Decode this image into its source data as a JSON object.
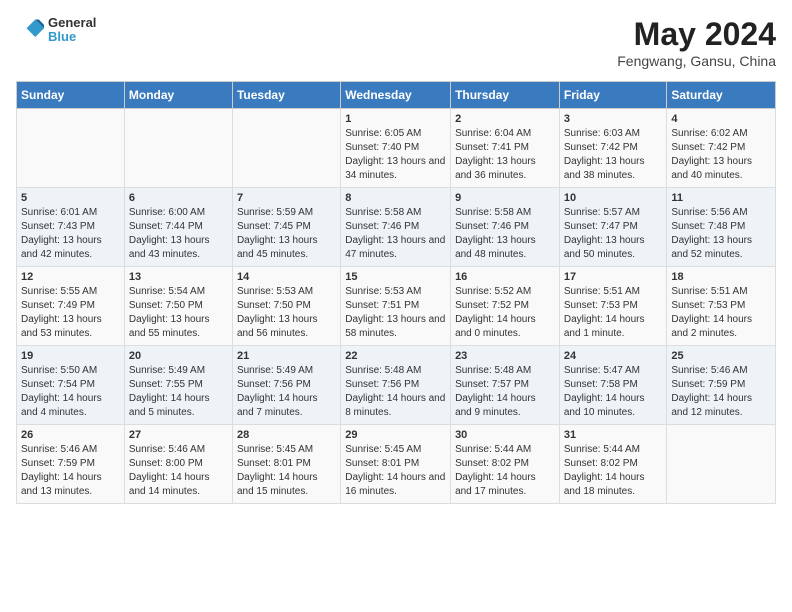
{
  "header": {
    "logo_line1": "General",
    "logo_line2": "Blue",
    "title": "May 2024",
    "subtitle": "Fengwang, Gansu, China"
  },
  "weekdays": [
    "Sunday",
    "Monday",
    "Tuesday",
    "Wednesday",
    "Thursday",
    "Friday",
    "Saturday"
  ],
  "weeks": [
    [
      {
        "day": "",
        "sunrise": "",
        "sunset": "",
        "daylight": ""
      },
      {
        "day": "",
        "sunrise": "",
        "sunset": "",
        "daylight": ""
      },
      {
        "day": "",
        "sunrise": "",
        "sunset": "",
        "daylight": ""
      },
      {
        "day": "1",
        "sunrise": "Sunrise: 6:05 AM",
        "sunset": "Sunset: 7:40 PM",
        "daylight": "Daylight: 13 hours and 34 minutes."
      },
      {
        "day": "2",
        "sunrise": "Sunrise: 6:04 AM",
        "sunset": "Sunset: 7:41 PM",
        "daylight": "Daylight: 13 hours and 36 minutes."
      },
      {
        "day": "3",
        "sunrise": "Sunrise: 6:03 AM",
        "sunset": "Sunset: 7:42 PM",
        "daylight": "Daylight: 13 hours and 38 minutes."
      },
      {
        "day": "4",
        "sunrise": "Sunrise: 6:02 AM",
        "sunset": "Sunset: 7:42 PM",
        "daylight": "Daylight: 13 hours and 40 minutes."
      }
    ],
    [
      {
        "day": "5",
        "sunrise": "Sunrise: 6:01 AM",
        "sunset": "Sunset: 7:43 PM",
        "daylight": "Daylight: 13 hours and 42 minutes."
      },
      {
        "day": "6",
        "sunrise": "Sunrise: 6:00 AM",
        "sunset": "Sunset: 7:44 PM",
        "daylight": "Daylight: 13 hours and 43 minutes."
      },
      {
        "day": "7",
        "sunrise": "Sunrise: 5:59 AM",
        "sunset": "Sunset: 7:45 PM",
        "daylight": "Daylight: 13 hours and 45 minutes."
      },
      {
        "day": "8",
        "sunrise": "Sunrise: 5:58 AM",
        "sunset": "Sunset: 7:46 PM",
        "daylight": "Daylight: 13 hours and 47 minutes."
      },
      {
        "day": "9",
        "sunrise": "Sunrise: 5:58 AM",
        "sunset": "Sunset: 7:46 PM",
        "daylight": "Daylight: 13 hours and 48 minutes."
      },
      {
        "day": "10",
        "sunrise": "Sunrise: 5:57 AM",
        "sunset": "Sunset: 7:47 PM",
        "daylight": "Daylight: 13 hours and 50 minutes."
      },
      {
        "day": "11",
        "sunrise": "Sunrise: 5:56 AM",
        "sunset": "Sunset: 7:48 PM",
        "daylight": "Daylight: 13 hours and 52 minutes."
      }
    ],
    [
      {
        "day": "12",
        "sunrise": "Sunrise: 5:55 AM",
        "sunset": "Sunset: 7:49 PM",
        "daylight": "Daylight: 13 hours and 53 minutes."
      },
      {
        "day": "13",
        "sunrise": "Sunrise: 5:54 AM",
        "sunset": "Sunset: 7:50 PM",
        "daylight": "Daylight: 13 hours and 55 minutes."
      },
      {
        "day": "14",
        "sunrise": "Sunrise: 5:53 AM",
        "sunset": "Sunset: 7:50 PM",
        "daylight": "Daylight: 13 hours and 56 minutes."
      },
      {
        "day": "15",
        "sunrise": "Sunrise: 5:53 AM",
        "sunset": "Sunset: 7:51 PM",
        "daylight": "Daylight: 13 hours and 58 minutes."
      },
      {
        "day": "16",
        "sunrise": "Sunrise: 5:52 AM",
        "sunset": "Sunset: 7:52 PM",
        "daylight": "Daylight: 14 hours and 0 minutes."
      },
      {
        "day": "17",
        "sunrise": "Sunrise: 5:51 AM",
        "sunset": "Sunset: 7:53 PM",
        "daylight": "Daylight: 14 hours and 1 minute."
      },
      {
        "day": "18",
        "sunrise": "Sunrise: 5:51 AM",
        "sunset": "Sunset: 7:53 PM",
        "daylight": "Daylight: 14 hours and 2 minutes."
      }
    ],
    [
      {
        "day": "19",
        "sunrise": "Sunrise: 5:50 AM",
        "sunset": "Sunset: 7:54 PM",
        "daylight": "Daylight: 14 hours and 4 minutes."
      },
      {
        "day": "20",
        "sunrise": "Sunrise: 5:49 AM",
        "sunset": "Sunset: 7:55 PM",
        "daylight": "Daylight: 14 hours and 5 minutes."
      },
      {
        "day": "21",
        "sunrise": "Sunrise: 5:49 AM",
        "sunset": "Sunset: 7:56 PM",
        "daylight": "Daylight: 14 hours and 7 minutes."
      },
      {
        "day": "22",
        "sunrise": "Sunrise: 5:48 AM",
        "sunset": "Sunset: 7:56 PM",
        "daylight": "Daylight: 14 hours and 8 minutes."
      },
      {
        "day": "23",
        "sunrise": "Sunrise: 5:48 AM",
        "sunset": "Sunset: 7:57 PM",
        "daylight": "Daylight: 14 hours and 9 minutes."
      },
      {
        "day": "24",
        "sunrise": "Sunrise: 5:47 AM",
        "sunset": "Sunset: 7:58 PM",
        "daylight": "Daylight: 14 hours and 10 minutes."
      },
      {
        "day": "25",
        "sunrise": "Sunrise: 5:46 AM",
        "sunset": "Sunset: 7:59 PM",
        "daylight": "Daylight: 14 hours and 12 minutes."
      }
    ],
    [
      {
        "day": "26",
        "sunrise": "Sunrise: 5:46 AM",
        "sunset": "Sunset: 7:59 PM",
        "daylight": "Daylight: 14 hours and 13 minutes."
      },
      {
        "day": "27",
        "sunrise": "Sunrise: 5:46 AM",
        "sunset": "Sunset: 8:00 PM",
        "daylight": "Daylight: 14 hours and 14 minutes."
      },
      {
        "day": "28",
        "sunrise": "Sunrise: 5:45 AM",
        "sunset": "Sunset: 8:01 PM",
        "daylight": "Daylight: 14 hours and 15 minutes."
      },
      {
        "day": "29",
        "sunrise": "Sunrise: 5:45 AM",
        "sunset": "Sunset: 8:01 PM",
        "daylight": "Daylight: 14 hours and 16 minutes."
      },
      {
        "day": "30",
        "sunrise": "Sunrise: 5:44 AM",
        "sunset": "Sunset: 8:02 PM",
        "daylight": "Daylight: 14 hours and 17 minutes."
      },
      {
        "day": "31",
        "sunrise": "Sunrise: 5:44 AM",
        "sunset": "Sunset: 8:02 PM",
        "daylight": "Daylight: 14 hours and 18 minutes."
      },
      {
        "day": "",
        "sunrise": "",
        "sunset": "",
        "daylight": ""
      }
    ]
  ]
}
